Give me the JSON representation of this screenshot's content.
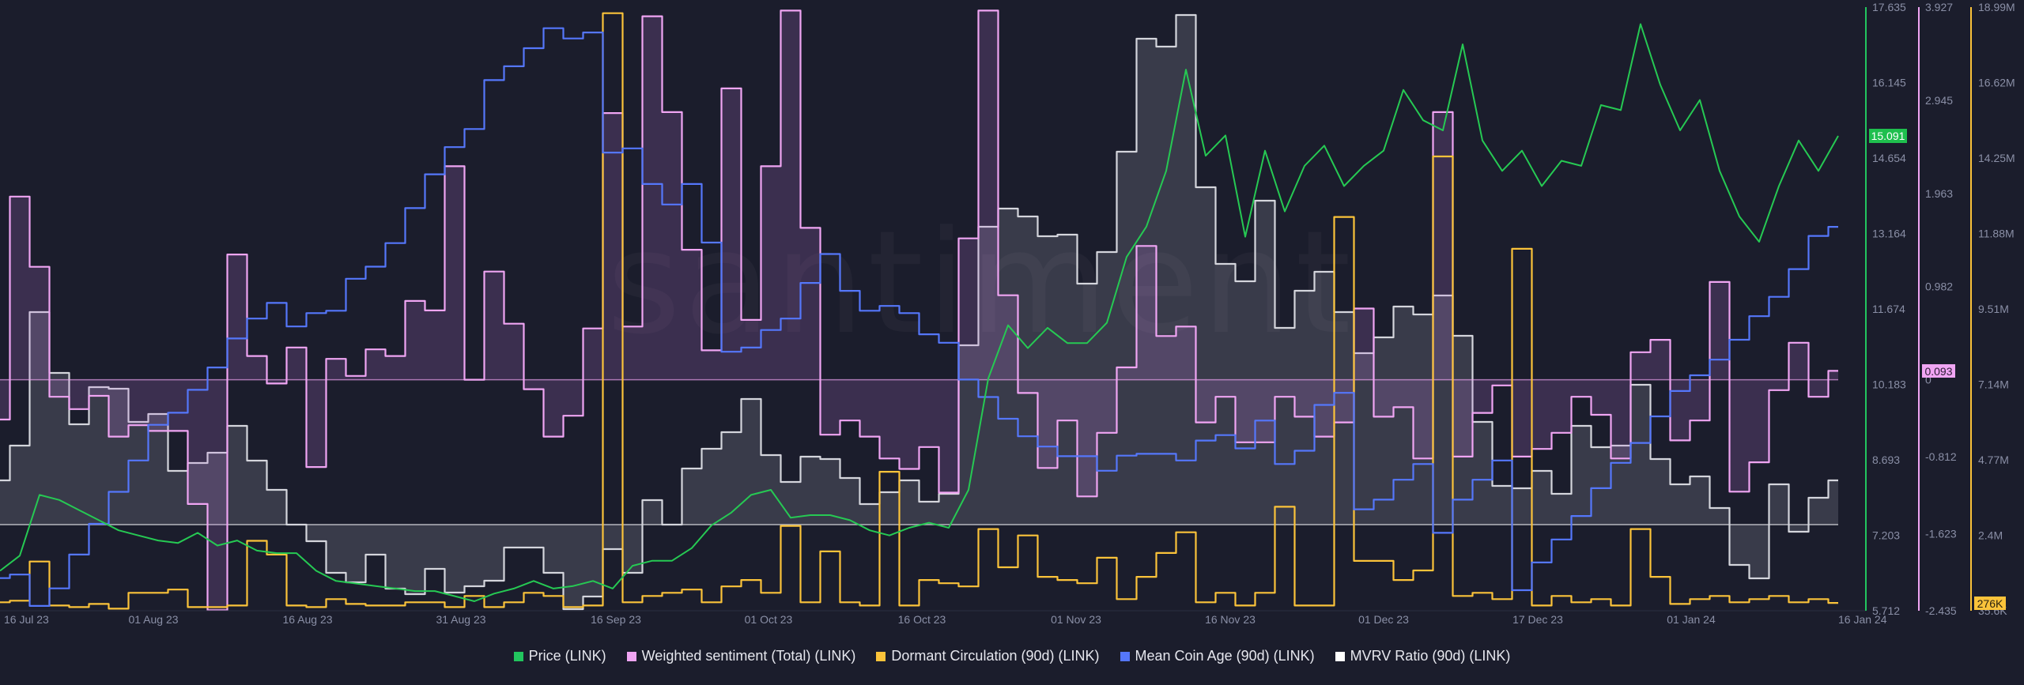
{
  "watermark": "santiment",
  "chart_data": {
    "type": "line",
    "title": "",
    "xlabel": "",
    "ylabel": "",
    "grid": false,
    "legend_position": "bottom-center",
    "x": {
      "start": "15 Jul 23",
      "end": "19 Jan 24",
      "interval": "2 days",
      "tick_labels": [
        "16 Jul 23",
        "01 Aug 23",
        "16 Aug 23",
        "31 Aug 23",
        "16 Sep 23",
        "01 Oct 23",
        "16 Oct 23",
        "01 Nov 23",
        "16 Nov 23",
        "01 Dec 23",
        "17 Dec 23",
        "01 Jan 24",
        "16 Jan 24"
      ]
    },
    "axes": {
      "price": {
        "color": "#22c55e",
        "ylim": [
          5.712,
          17.635
        ],
        "ticks": [
          "17.635",
          "16.145",
          "14.654",
          "13.164",
          "11.674",
          "10.183",
          "8.693",
          "7.203",
          "5.712"
        ],
        "current_value": "15.091"
      },
      "sentiment": {
        "color": "#f0a5f3",
        "ylim": [
          -2.435,
          3.927
        ],
        "ticks": [
          "3.927",
          "2.945",
          "1.963",
          "0.982",
          "0",
          "-0.812",
          "-1.623",
          "-2.435"
        ],
        "tick_values": [
          3.927,
          2.945,
          1.963,
          0.982,
          0,
          -0.812,
          -1.623,
          -2.435
        ],
        "current_value": "0.093"
      },
      "dormant": {
        "color": "#fbc33a",
        "unit": "M",
        "ylim": [
          0.0356,
          18.99
        ],
        "ticks": [
          "18.99M",
          "16.62M",
          "14.25M",
          "11.88M",
          "9.51M",
          "7.14M",
          "4.77M",
          "2.4M",
          "35.6K"
        ],
        "current_value": "276K"
      },
      "mean_coin_age": {
        "hidden": true,
        "unit": "index",
        "ylim": [
          0,
          100
        ]
      },
      "mvrv": {
        "hidden": true,
        "unit": "ratio",
        "ylim": [
          -0.109,
          0.655
        ],
        "baseline": 0
      }
    },
    "series": [
      {
        "key": "mvrv",
        "name": "MVRV Ratio (90d) (LINK)",
        "color": "#d4d5dc",
        "style": "step-area",
        "axis": "mvrv",
        "values": [
          0.056,
          0.1,
          0.269,
          0.192,
          0.127,
          0.174,
          0.172,
          0.13,
          0.14,
          0.068,
          0.078,
          0.091,
          0.125,
          0.081,
          0.044,
          0.0,
          -0.021,
          -0.061,
          -0.073,
          -0.038,
          -0.081,
          -0.088,
          -0.056,
          -0.086,
          -0.078,
          -0.071,
          -0.029,
          -0.029,
          -0.061,
          -0.107,
          -0.091,
          -0.031,
          -0.061,
          0.031,
          0.0,
          0.071,
          0.096,
          0.117,
          0.159,
          0.088,
          0.054,
          0.086,
          0.083,
          0.059,
          0.026,
          0.041,
          0.056,
          0.029,
          0.039,
          0.227,
          0.377,
          0.4,
          0.39,
          0.365,
          0.367,
          0.305,
          0.345,
          0.472,
          0.615,
          0.605,
          0.645,
          0.427,
          0.33,
          0.308,
          0.41,
          0.249,
          0.296,
          0.32,
          0.269,
          0.217,
          0.237,
          0.276,
          0.266,
          0.29,
          0.239,
          0.13,
          0.049,
          0.046,
          0.068,
          0.039,
          0.125,
          0.098,
          0.1,
          0.177,
          0.083,
          0.051,
          0.061,
          0.021,
          -0.051,
          -0.068,
          0.051,
          -0.009,
          0.034,
          0.056
        ]
      },
      {
        "key": "sentiment",
        "name": "Weighted sentiment (Total) (LINK)",
        "color": "#f0a5f3",
        "style": "step-area",
        "axis": "sentiment",
        "values": [
          -0.42,
          1.93,
          1.19,
          -0.18,
          -0.31,
          -0.17,
          -0.6,
          -0.48,
          -0.54,
          -0.54,
          -1.31,
          -2.43,
          1.32,
          0.25,
          -0.04,
          0.34,
          -0.92,
          0.22,
          0.04,
          0.32,
          0.25,
          0.83,
          0.73,
          2.25,
          0.0,
          1.14,
          0.59,
          -0.1,
          -0.6,
          -0.38,
          0.54,
          2.81,
          0.56,
          3.83,
          2.82,
          1.37,
          0.31,
          3.07,
          0.63,
          2.25,
          3.89,
          1.6,
          -0.58,
          -0.43,
          -0.6,
          -0.83,
          -0.94,
          -0.71,
          -1.19,
          1.49,
          3.89,
          0.89,
          -0.14,
          -0.93,
          -0.43,
          -1.23,
          -0.56,
          0.13,
          1.41,
          0.46,
          0.56,
          -0.45,
          -0.18,
          -0.66,
          -0.66,
          -0.18,
          -0.39,
          -0.6,
          -0.45,
          0.75,
          -0.39,
          -0.29,
          -0.83,
          2.82,
          -0.81,
          -0.35,
          -0.06,
          -0.81,
          -0.73,
          -0.56,
          -0.18,
          -0.37,
          -0.83,
          0.29,
          0.42,
          -0.64,
          -0.43,
          1.03,
          -1.18,
          -0.87,
          -0.11,
          0.39,
          -0.18,
          0.093
        ]
      },
      {
        "key": "dormant",
        "name": "Dormant Circulation (90d) (LINK)",
        "color": "#fbc33a",
        "style": "step",
        "axis": "dormant",
        "values": [
          0.3,
          0.35,
          1.58,
          0.2,
          0.15,
          0.25,
          0.1,
          0.6,
          0.6,
          0.7,
          0.15,
          0.15,
          0.2,
          2.23,
          1.8,
          0.2,
          0.15,
          0.4,
          0.25,
          0.2,
          0.2,
          0.3,
          0.3,
          0.15,
          0.5,
          0.15,
          0.3,
          0.6,
          0.5,
          0.15,
          0.2,
          18.8,
          0.3,
          0.5,
          0.6,
          0.7,
          0.3,
          0.8,
          1.0,
          0.6,
          2.7,
          0.3,
          1.9,
          0.3,
          0.2,
          4.4,
          0.2,
          1.0,
          0.9,
          0.8,
          2.6,
          1.4,
          2.4,
          1.1,
          1.0,
          0.9,
          1.7,
          0.4,
          1.1,
          1.85,
          2.5,
          0.3,
          0.6,
          0.2,
          0.6,
          3.3,
          0.2,
          0.2,
          12.4,
          1.6,
          1.6,
          1.0,
          1.3,
          14.3,
          0.5,
          0.6,
          0.4,
          11.4,
          0.2,
          0.5,
          0.3,
          0.4,
          0.2,
          2.6,
          1.1,
          0.25,
          0.4,
          0.5,
          0.3,
          0.4,
          0.5,
          0.3,
          0.4,
          0.28
        ]
      },
      {
        "key": "mean_coin_age",
        "name": "Mean Coin Age (90d) (LINK)",
        "color": "#5577fb",
        "style": "step",
        "axis": "mean_coin_age",
        "values": [
          5.4,
          6.0,
          0.8,
          3.7,
          9.3,
          14.4,
          19.7,
          24.9,
          30.8,
          32.8,
          36.6,
          40.3,
          45.1,
          48.4,
          51.0,
          47.1,
          49.3,
          49.7,
          55.0,
          57.0,
          60.9,
          66.7,
          72.3,
          76.8,
          79.8,
          87.9,
          90.2,
          93.2,
          96.5,
          94.8,
          95.8,
          75.9,
          76.6,
          70.7,
          67.3,
          70.7,
          61.0,
          42.9,
          43.6,
          46.5,
          48.4,
          54.3,
          59.1,
          53.0,
          49.7,
          50.5,
          49.3,
          45.8,
          44.4,
          38.3,
          35.4,
          31.8,
          28.9,
          27.2,
          25.6,
          25.6,
          23.2,
          25.7,
          26.0,
          26.0,
          24.9,
          28.2,
          29.1,
          26.9,
          31.5,
          24.3,
          26.5,
          34.1,
          36.1,
          16.8,
          18.4,
          21.7,
          24.3,
          12.9,
          18.4,
          21.7,
          24.9,
          3.4,
          8.0,
          11.8,
          15.7,
          20.3,
          24.5,
          27.8,
          32.2,
          36.4,
          39.0,
          41.6,
          44.9,
          48.8,
          52.0,
          56.6,
          62.1,
          63.6
        ]
      },
      {
        "key": "price",
        "name": "Price (LINK)",
        "color": "#26c953",
        "style": "line",
        "axis": "price",
        "values": [
          6.5,
          6.8,
          8.0,
          7.9,
          7.7,
          7.5,
          7.3,
          7.2,
          7.1,
          7.05,
          7.25,
          7.0,
          7.1,
          6.9,
          6.85,
          6.85,
          6.5,
          6.3,
          6.25,
          6.2,
          6.15,
          6.1,
          6.1,
          6.0,
          5.9,
          6.05,
          6.15,
          6.3,
          6.15,
          6.2,
          6.3,
          6.15,
          6.6,
          6.7,
          6.7,
          6.95,
          7.4,
          7.65,
          8.0,
          8.1,
          7.55,
          7.6,
          7.6,
          7.5,
          7.3,
          7.2,
          7.35,
          7.45,
          7.35,
          8.1,
          10.3,
          11.35,
          10.9,
          11.3,
          11.0,
          11.0,
          11.4,
          12.7,
          13.3,
          14.4,
          16.4,
          14.7,
          15.1,
          13.1,
          14.8,
          13.6,
          14.5,
          14.9,
          14.1,
          14.5,
          14.8,
          16.0,
          15.4,
          15.2,
          16.9,
          15.0,
          14.4,
          14.8,
          14.1,
          14.6,
          14.5,
          15.7,
          15.6,
          17.3,
          16.1,
          15.2,
          15.8,
          14.4,
          13.5,
          13.0,
          14.1,
          15.0,
          14.4,
          15.091
        ]
      }
    ]
  },
  "legend": [
    {
      "label": "Price (LINK)",
      "color": "#22c55e"
    },
    {
      "label": "Weighted sentiment (Total) (LINK)",
      "color": "#f0a5f3"
    },
    {
      "label": "Dormant Circulation (90d) (LINK)",
      "color": "#fbc33a"
    },
    {
      "label": "Mean Coin Age (90d) (LINK)",
      "color": "#5577fb"
    },
    {
      "label": "MVRV Ratio (90d) (LINK)",
      "color": "#ffffff"
    }
  ]
}
